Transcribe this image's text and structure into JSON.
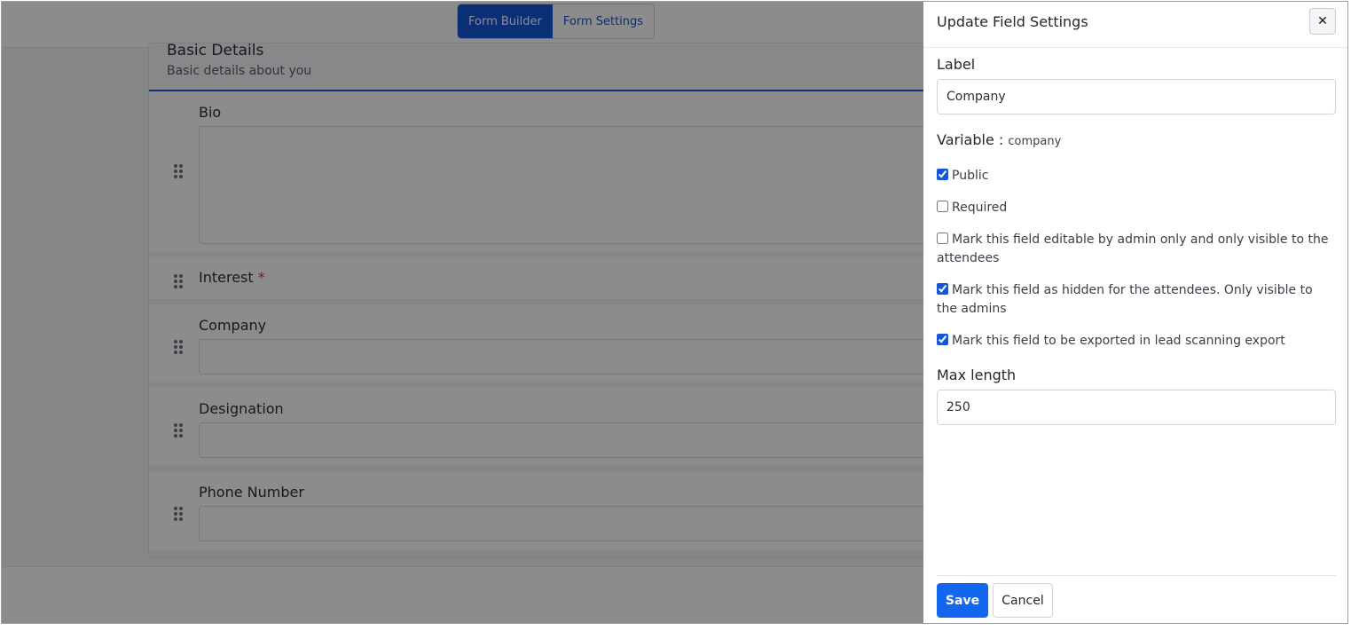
{
  "topbar": {
    "tabs": [
      {
        "label": "Form Builder"
      },
      {
        "label": "Form Settings"
      }
    ]
  },
  "section": {
    "title": "Basic Details",
    "subtitle": "Basic details about you"
  },
  "fields": [
    {
      "label": "Bio"
    },
    {
      "label": "Interest",
      "required_mark": "*"
    },
    {
      "label": "Company"
    },
    {
      "label": "Designation"
    },
    {
      "label": "Phone Number"
    }
  ],
  "panel": {
    "title": "Update Field Settings",
    "close_label": "✕",
    "label_title": "Label",
    "label_value": "Company",
    "variable_title": "Variable :",
    "variable_value": "company",
    "checkboxes": [
      {
        "label": "Public",
        "checked": true
      },
      {
        "label": "Required",
        "checked": false
      },
      {
        "label": "Mark this field editable by admin only and only visible to the attendees",
        "checked": false
      },
      {
        "label": "Mark this field as hidden for the attendees. Only visible to the admins",
        "checked": true
      },
      {
        "label": "Mark this field to be exported in lead scanning export",
        "checked": true
      }
    ],
    "maxlength_title": "Max length",
    "maxlength_value": "250",
    "save_label": "Save",
    "cancel_label": "Cancel"
  }
}
